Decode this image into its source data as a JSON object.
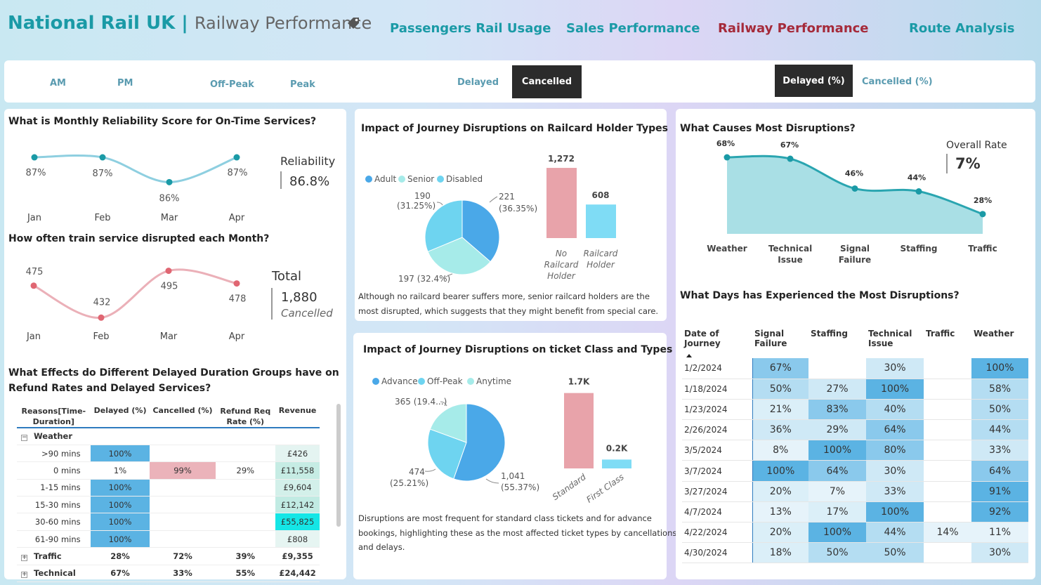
{
  "header": {
    "brand": "National Rail UK",
    "separator": " | ",
    "subtitle": "Railway Performance",
    "nav": [
      "Passengers Rail Usage",
      "Sales Performance",
      "Railway Performance",
      "Route Analysis"
    ],
    "active_nav": "Railway Performance"
  },
  "slicers": {
    "time": [
      "AM",
      "PM",
      "Off-Peak",
      "Peak"
    ],
    "status": [
      "Delayed",
      "Cancelled"
    ],
    "status_selected": "Cancelled",
    "metric": [
      "Delayed (%)",
      "Cancelled (%)"
    ],
    "metric_selected": "Delayed (%)"
  },
  "reliability": {
    "title": "What is Monthly Reliability Score for On-Time Services?",
    "kpi_label": "Reliability",
    "kpi_value": "86.8%",
    "months": [
      "Jan",
      "Feb",
      "Mar",
      "Apr"
    ],
    "values": [
      87,
      87,
      86,
      87
    ],
    "labels": [
      "87%",
      "87%",
      "86%",
      "87%"
    ],
    "color": "#1a9aa6"
  },
  "disrupted": {
    "title": "How often train service disrupted each Month?",
    "kpi_label": "Total",
    "kpi_value": "1,880",
    "kpi_sub": "Cancelled",
    "months": [
      "Jan",
      "Feb",
      "Mar",
      "Apr"
    ],
    "values": [
      475,
      432,
      495,
      478
    ],
    "color": "#e06672"
  },
  "railcard": {
    "title": "Impact of Journey Disruptions on Railcard Holder Types",
    "legend": [
      "Adult",
      "Senior",
      "Disabled"
    ],
    "legend_colors": [
      "#4aa8e8",
      "#a6ebe9",
      "#6ed4f0"
    ],
    "pie": [
      {
        "name": "Adult",
        "value": 221,
        "label": "221",
        "pct": "(36.35%)"
      },
      {
        "name": "Senior",
        "value": 197,
        "label": "197 (32.4%)"
      },
      {
        "name": "Disabled",
        "value": 190,
        "label": "190",
        "pct": "(31.25%)"
      }
    ],
    "bars": [
      {
        "name": "No Railcard Holder",
        "lines": [
          "No",
          "Railcard",
          "Holder"
        ],
        "value": 1272,
        "label": "1,272",
        "color": "#e8a3aa"
      },
      {
        "name": "Railcard Holder",
        "lines": [
          "Railcard",
          "Holder"
        ],
        "value": 608,
        "label": "608",
        "color": "#7fdcf5"
      }
    ],
    "note_lines": [
      "Although no railcard bearer suffers more, senior railcard holders are the",
      "most disrupted, which suggests that they might benefit from special care."
    ]
  },
  "ticket": {
    "title": "Impact of Journey Disruptions on ticket Class and Types",
    "legend": [
      "Advance",
      "Off-Peak",
      "Anytime"
    ],
    "legend_colors": [
      "#4aa8e8",
      "#6ed4f0",
      "#a6ebe9"
    ],
    "pie": [
      {
        "name": "Advance",
        "value": 1041,
        "label": "1,041",
        "pct": "(55.37%)"
      },
      {
        "name": "Off-Peak",
        "value": 474,
        "label": "474",
        "pct": "(25.21%)"
      },
      {
        "name": "Anytime",
        "value": 365,
        "label": "365 (19.4...)"
      }
    ],
    "bars": [
      {
        "name": "Standard",
        "value": 1.7,
        "label": "1.7K",
        "color": "#e8a3aa"
      },
      {
        "name": "First Class",
        "value": 0.2,
        "label": "0.2K",
        "color": "#7fdcf5"
      }
    ],
    "note_lines": [
      "Disruptions are most frequent for standard class tickets and for advance",
      "bookings, highlighting these as the most affected ticket types by cancellations",
      "and delays."
    ]
  },
  "causes": {
    "title": "What Causes Most Disruptions?",
    "kpi_label": "Overall Rate",
    "kpi_value": "7%",
    "categories": [
      [
        "Weather"
      ],
      [
        "Technical",
        "Issue"
      ],
      [
        "Signal",
        "Failure"
      ],
      [
        "Staffing"
      ],
      [
        "Traffic"
      ]
    ],
    "values": [
      68,
      67,
      46,
      44,
      28
    ],
    "labels": [
      "68%",
      "67%",
      "46%",
      "44%",
      "28%"
    ]
  },
  "refund": {
    "title_lines": [
      "What Effects do Different Delayed Duration Groups have on",
      "Refund Rates and Delayed Services?"
    ],
    "columns": [
      "Reasons[Time-Duration]",
      "Delayed (%)",
      "Cancelled (%)",
      "Refund Req Rate (%)",
      "Revenue"
    ],
    "groups": [
      {
        "reason": "Weather",
        "expanded": true,
        "rows": [
          {
            "label": ">90 mins",
            "delayed": "100%",
            "cancelled": "",
            "refund": "",
            "revenue": "£426"
          },
          {
            "label": "0 mins",
            "delayed": "1%",
            "cancelled": "99%",
            "refund": "29%",
            "revenue": "£11,558"
          },
          {
            "label": "1-15 mins",
            "delayed": "100%",
            "cancelled": "",
            "refund": "",
            "revenue": "£9,604"
          },
          {
            "label": "15-30 mins",
            "delayed": "100%",
            "cancelled": "",
            "refund": "",
            "revenue": "£12,142"
          },
          {
            "label": "30-60 mins",
            "delayed": "100%",
            "cancelled": "",
            "refund": "",
            "revenue": "£55,825"
          },
          {
            "label": "61-90 mins",
            "delayed": "100%",
            "cancelled": "",
            "refund": "",
            "revenue": "£808"
          }
        ]
      },
      {
        "reason": "Traffic",
        "expanded": false,
        "delayed": "28%",
        "cancelled": "72%",
        "refund": "39%",
        "revenue": "£9,355"
      },
      {
        "reason": "Technical",
        "expanded": false,
        "delayed": "67%",
        "cancelled": "33%",
        "refund": "55%",
        "revenue": "£24,442"
      }
    ]
  },
  "days": {
    "title": "What Days has Experienced the Most Disruptions?",
    "columns": [
      "Date of Journey",
      "Signal Failure",
      "Staffing",
      "Technical Issue",
      "Traffic",
      "Weather"
    ],
    "rows": [
      [
        "1/2/2024",
        "67%",
        "",
        "30%",
        "",
        "100%"
      ],
      [
        "1/18/2024",
        "50%",
        "27%",
        "100%",
        "",
        "58%"
      ],
      [
        "1/23/2024",
        "21%",
        "83%",
        "40%",
        "",
        "50%"
      ],
      [
        "2/26/2024",
        "36%",
        "29%",
        "64%",
        "",
        "44%"
      ],
      [
        "3/5/2024",
        "8%",
        "100%",
        "80%",
        "",
        "33%"
      ],
      [
        "3/7/2024",
        "100%",
        "64%",
        "30%",
        "",
        "64%"
      ],
      [
        "3/27/2024",
        "20%",
        "7%",
        "33%",
        "",
        "91%"
      ],
      [
        "4/7/2024",
        "13%",
        "17%",
        "100%",
        "",
        "92%"
      ],
      [
        "4/22/2024",
        "20%",
        "100%",
        "44%",
        "14%",
        "11%"
      ],
      [
        "4/30/2024",
        "18%",
        "50%",
        "50%",
        "",
        "30%"
      ]
    ]
  }
}
